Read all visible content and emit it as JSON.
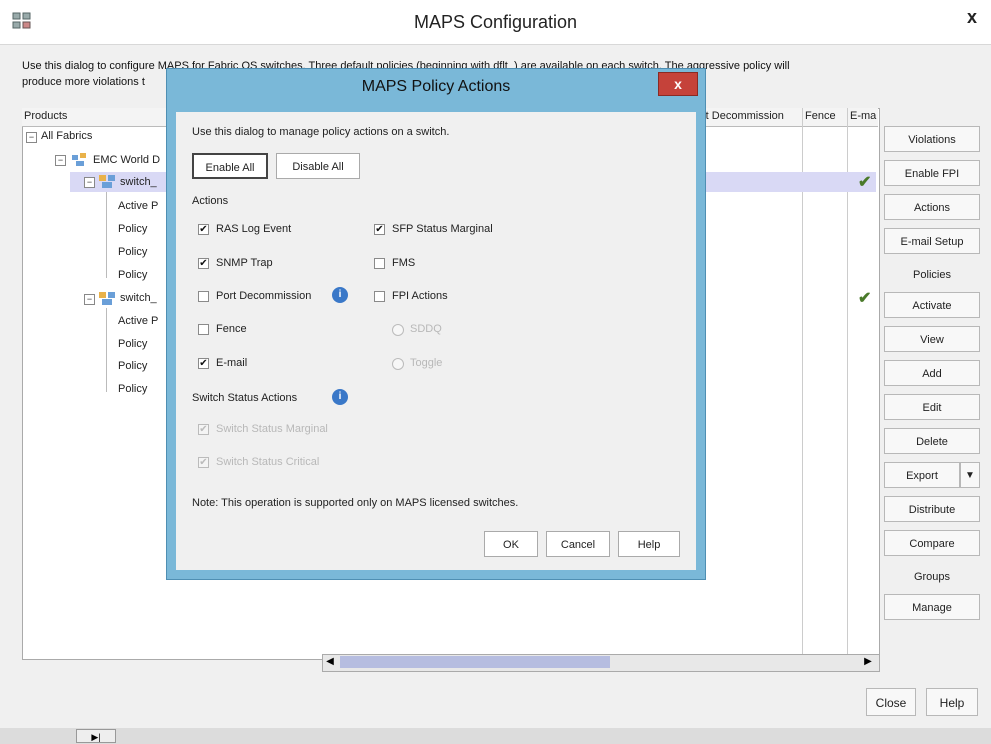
{
  "window": {
    "title": "MAPS Configuration",
    "close_glyph": "x",
    "description_line1": "Use this dialog to configure MAPS for Fabric OS switches. Three default policies (beginning with dflt_) are available on each switch. The aggressive policy will",
    "description_line2": "produce more violations t"
  },
  "table": {
    "header_products": "Products",
    "header_port_decommission": "rt Decommission",
    "header_fence": "Fence",
    "header_email": "E-ma",
    "rows": [
      {
        "label": "All Fabrics"
      },
      {
        "label": "EMC World D"
      },
      {
        "label": "switch_"
      },
      {
        "label": "Active P"
      },
      {
        "label": "Policy"
      },
      {
        "label": "Policy"
      },
      {
        "label": "Policy"
      },
      {
        "label": "switch_"
      },
      {
        "label": "Active P"
      },
      {
        "label": "Policy"
      },
      {
        "label": "Policy"
      },
      {
        "label": "Policy"
      }
    ],
    "check_glyph": "✔"
  },
  "right_panel": {
    "violations": "Violations",
    "enable_fpi": "Enable FPI",
    "actions": "Actions",
    "email_setup": "E-mail Setup",
    "policies_label": "Policies",
    "activate": "Activate",
    "view": "View",
    "add": "Add",
    "edit": "Edit",
    "delete": "Delete",
    "export": "Export",
    "distribute": "Distribute",
    "compare": "Compare",
    "groups_label": "Groups",
    "manage": "Manage"
  },
  "footer": {
    "close": "Close",
    "help": "Help"
  },
  "modal": {
    "title": "MAPS Policy Actions",
    "close_glyph": "x",
    "intro": "Use this dialog to manage policy actions on a switch.",
    "enable_all": "Enable All",
    "disable_all": "Disable All",
    "actions_label": "Actions",
    "ras_log_event": "RAS Log Event",
    "snmp_trap": "SNMP Trap",
    "port_decommission": "Port Decommission",
    "fence": "Fence",
    "email": "E-mail",
    "sfp_status_marginal": "SFP Status Marginal",
    "fms": "FMS",
    "fpi_actions": "FPI Actions",
    "sddq": "SDDQ",
    "toggle": "Toggle",
    "switch_status_actions": "Switch Status Actions",
    "switch_status_marginal": "Switch Status Marginal",
    "switch_status_critical": "Switch Status Critical",
    "note": "Note: This operation is supported only on MAPS licensed switches.",
    "ok": "OK",
    "cancel": "Cancel",
    "help": "Help",
    "checked_glyph": "✔",
    "info_glyph": "i"
  },
  "colors": {
    "modal_border": "#7ab8d8",
    "close_red": "#c5423a",
    "selection": "#d9d9f5",
    "scroll_thumb": "#b6bde0",
    "check_green": "#4a7a2a"
  }
}
